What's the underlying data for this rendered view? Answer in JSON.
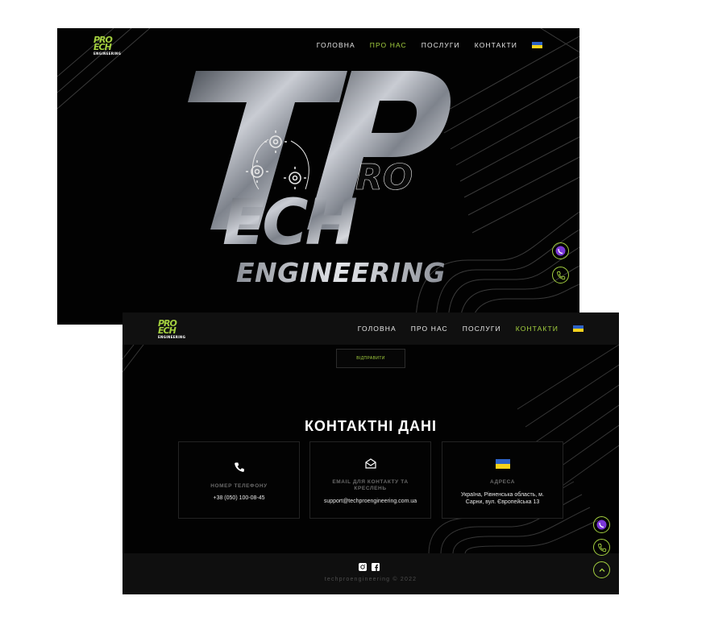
{
  "brand": {
    "logo_line1": "PRO",
    "logo_line2": "ECH",
    "logo_line3": "ENGINEERING",
    "accent_color": "#a4d03f"
  },
  "hero_screen": {
    "nav": [
      "ГОЛОВНА",
      "ПРО НАС",
      "ПОСЛУГИ",
      "КОНТАКТИ"
    ],
    "active_index": 1,
    "hero_logo": {
      "top": "PRO",
      "mid": "ECH",
      "bottom": "ENGINEERING"
    },
    "icons": [
      "viber-icon",
      "phone-icon",
      "gear-icon"
    ]
  },
  "contacts_screen": {
    "nav": [
      "ГОЛОВНА",
      "ПРО НАС",
      "ПОСЛУГИ",
      "КОНТАКТИ"
    ],
    "active_index": 3,
    "send_button": "ВІДПРАВИТИ",
    "title": "КОНТАКТНІ ДАНІ",
    "cards": [
      {
        "icon": "phone-icon",
        "label": "НОМЕР ТЕЛЕФОНУ",
        "value": "+38 (050) 100-08-45"
      },
      {
        "icon": "envelope-icon",
        "label": "EMAIL ДЛЯ КОНТАКТУ ТА КРЕСЛЕНЬ",
        "value": "support@techproengineering.com.ua"
      },
      {
        "icon": "ukraine-flag-icon",
        "label": "АДРЕСА",
        "value": "Україна, Рівненська область, м. Сарни, вул. Європейська 13"
      }
    ],
    "footer": {
      "copyright": "techproengineering © 2022"
    }
  },
  "colors": {
    "background": "#020202",
    "accent": "#a4d03f",
    "viber": "#7b38d8",
    "flag_blue": "#2d62c6",
    "flag_yellow": "#f6d31c"
  }
}
